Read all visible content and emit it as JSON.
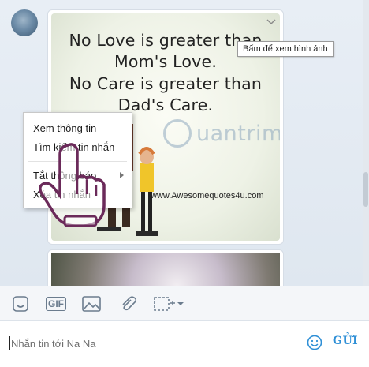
{
  "message": {
    "quote_lines": [
      "No Love is greater than",
      "Mom's Love.",
      "No Care is greater than",
      "Dad's Care."
    ],
    "watermark": "uantrimang",
    "site_text": "www.Awesomequotes4u.com",
    "tooltip": "Bấm để xem hình ảnh"
  },
  "context_menu": {
    "items": [
      "Xem thông tin",
      "Tìm kiếm tin nhắn",
      "Tắt thông báo",
      "Xóa tin nhắn"
    ]
  },
  "toolbar": {
    "tools": [
      "emoji-icon",
      "gif-icon",
      "image-icon",
      "attachment-icon",
      "screenshot-icon"
    ],
    "gif_label": "GIF"
  },
  "composer": {
    "placeholder": "Nhắn tin tới Na Na",
    "send_label": "GỬI"
  },
  "colors": {
    "accent": "#2e8fd6",
    "chat_bg": "#e8eef5"
  }
}
